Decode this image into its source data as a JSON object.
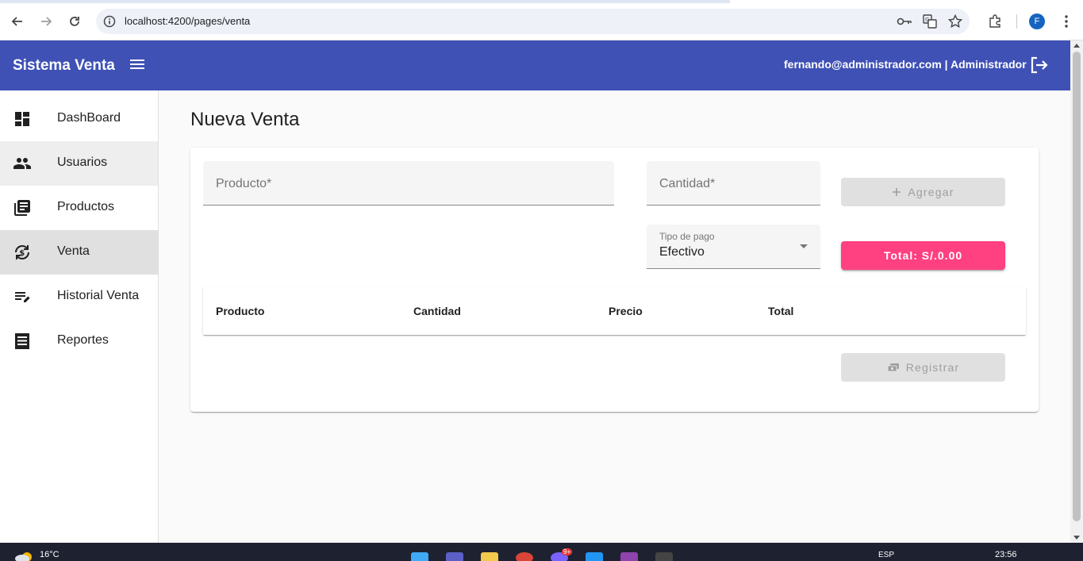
{
  "browser": {
    "url": "localhost:4200/pages/venta",
    "profile_initial": "F"
  },
  "app": {
    "title": "Sistema Venta",
    "user_info": "fernando@administrador.com | Administrador"
  },
  "sidebar": {
    "items": [
      {
        "label": "DashBoard",
        "icon": "dashboard-icon"
      },
      {
        "label": "Usuarios",
        "icon": "people-icon"
      },
      {
        "label": "Productos",
        "icon": "library-books-icon"
      },
      {
        "label": "Venta",
        "icon": "currency-exchange-icon"
      },
      {
        "label": "Historial Venta",
        "icon": "edit-note-icon"
      },
      {
        "label": "Reportes",
        "icon": "receipt-icon"
      }
    ]
  },
  "main": {
    "page_title": "Nueva Venta",
    "form": {
      "producto_label": "Producto*",
      "cantidad_label": "Cantidad*",
      "tipo_pago_label": "Tipo de pago",
      "tipo_pago_value": "Efectivo",
      "agregar_button": "Agregar",
      "total_button": "Total: S/.0.00",
      "registrar_button": "Registrar"
    },
    "table": {
      "columns": [
        "Producto",
        "Cantidad",
        "Precio",
        "Total"
      ]
    }
  },
  "taskbar": {
    "weather": "16°C",
    "language": "ESP",
    "time": "23:56",
    "badge": "9+"
  },
  "colors": {
    "primary": "#3f51b5",
    "accent": "#ff4081"
  }
}
